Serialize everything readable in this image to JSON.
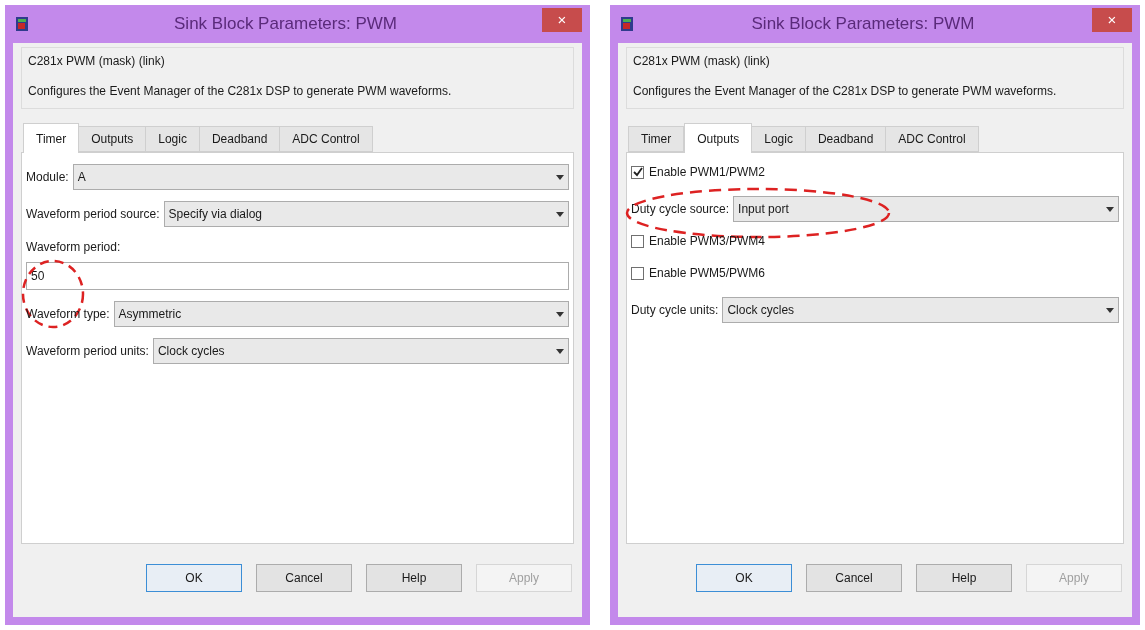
{
  "windows": [
    {
      "title": "Sink Block Parameters: PWM",
      "close": "×",
      "mask_name": "C281x PWM (mask) (link)",
      "description": "Configures the Event Manager of the C281x DSP to generate PWM waveforms.",
      "tabs": [
        {
          "label": "Timer",
          "selected": true
        },
        {
          "label": "Outputs",
          "selected": false
        },
        {
          "label": "Logic",
          "selected": false
        },
        {
          "label": "Deadband",
          "selected": false
        },
        {
          "label": "ADC Control",
          "selected": false
        }
      ],
      "rows": [
        {
          "kind": "dropdown",
          "label": "Module:",
          "value": "A",
          "highlighted": false
        },
        {
          "kind": "dropdown",
          "label": "Waveform period source:",
          "value": "Specify via dialog",
          "highlighted": false
        },
        {
          "kind": "textfield",
          "label": "Waveform period:",
          "value": "50",
          "highlighted": true
        },
        {
          "kind": "dropdown",
          "label": "Waveform type:",
          "value": "Asymmetric",
          "highlighted": false
        },
        {
          "kind": "dropdown",
          "label": "Waveform period units:",
          "value": "Clock cycles",
          "highlighted": false
        }
      ],
      "buttons": [
        {
          "label": "OK",
          "disabled": false,
          "default": true
        },
        {
          "label": "Cancel",
          "disabled": false,
          "default": false
        },
        {
          "label": "Help",
          "disabled": false,
          "default": false
        },
        {
          "label": "Apply",
          "disabled": true,
          "default": false
        }
      ]
    },
    {
      "title": "Sink Block Parameters: PWM",
      "close": "×",
      "mask_name": "C281x PWM (mask) (link)",
      "description": "Configures the Event Manager of the C281x DSP to generate PWM waveforms.",
      "tabs": [
        {
          "label": "Timer",
          "selected": false
        },
        {
          "label": "Outputs",
          "selected": true
        },
        {
          "label": "Logic",
          "selected": false
        },
        {
          "label": "Deadband",
          "selected": false
        },
        {
          "label": "ADC Control",
          "selected": false
        }
      ],
      "rows": [
        {
          "kind": "checkbox",
          "label": "Enable PWM1/PWM2",
          "checked": true,
          "highlighted": false
        },
        {
          "kind": "dropdown",
          "label": "Duty cycle source:",
          "value": "Input port",
          "highlighted": true
        },
        {
          "kind": "checkbox",
          "label": "Enable PWM3/PWM4",
          "checked": false,
          "highlighted": false
        },
        {
          "kind": "checkbox",
          "label": "Enable PWM5/PWM6",
          "checked": false,
          "highlighted": false
        },
        {
          "kind": "dropdown",
          "label": "Duty cycle units:",
          "value": "Clock cycles",
          "highlighted": false
        }
      ],
      "buttons": [
        {
          "label": "OK",
          "disabled": false,
          "default": true
        },
        {
          "label": "Cancel",
          "disabled": false,
          "default": false
        },
        {
          "label": "Help",
          "disabled": false,
          "default": false
        },
        {
          "label": "Apply",
          "disabled": true,
          "default": false
        }
      ]
    }
  ]
}
